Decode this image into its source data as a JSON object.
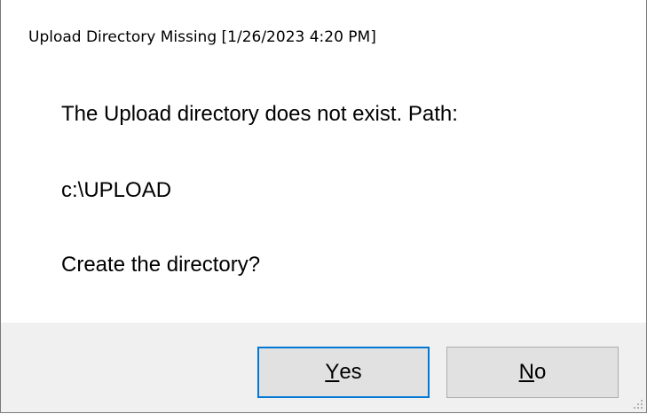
{
  "window": {
    "title": "Upload Directory Missing [1/26/2023 4:20 PM]"
  },
  "message": {
    "line1": "The Upload directory does not exist. Path:",
    "line2": "c:\\UPLOAD",
    "line3": "Create the directory?"
  },
  "buttons": {
    "yes": {
      "mnemonic": "Y",
      "rest": "es"
    },
    "no": {
      "mnemonic": "N",
      "rest": "o"
    }
  },
  "colors": {
    "focus_border": "#0078d7",
    "footer_bg": "#f0f0f0",
    "button_bg": "#e1e1e1"
  }
}
